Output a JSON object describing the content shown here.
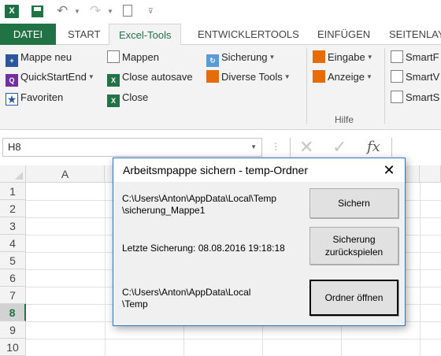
{
  "window": {
    "quick_access": {
      "undo_icon": "undo-icon",
      "redo_icon": "redo-icon",
      "new_document_icon": "new-document-icon"
    },
    "app_icon": "X"
  },
  "ribbon": {
    "tabs": [
      {
        "label": "DATEI"
      },
      {
        "label": "START"
      },
      {
        "label": "Excel-Tools"
      },
      {
        "label": "ENTWICKLERTOOLS"
      },
      {
        "label": "EINFÜGEN"
      },
      {
        "label": "SEITENLAY"
      }
    ],
    "active_tab": "Excel-Tools",
    "buttons": {
      "mappe_neu": "Mappe neu",
      "quickstartend": "QuickStartEnd",
      "favoriten": "Favoriten",
      "mappen": "Mappen",
      "close_autosave": "Close autosave",
      "close": "Close",
      "sicherung": "Sicherung",
      "diverse_tools": "Diverse Tools",
      "eingabe": "Eingabe",
      "anzeige": "Anzeige",
      "smartf": "SmartF",
      "smartv": "SmartV",
      "smarts": "SmartS"
    },
    "group_label_hilfe": "Hilfe"
  },
  "formula_bar": {
    "name_box": "H8",
    "fx_label": "fx"
  },
  "grid": {
    "column_a": "A",
    "rows": [
      "1",
      "2",
      "3",
      "4",
      "5",
      "6",
      "7",
      "8",
      "9",
      "10"
    ],
    "selected_row": "8"
  },
  "dialog": {
    "title": "Arbeitsmpappe sichern - temp-Ordner",
    "path_line1": "C:\\Users\\Anton\\AppData\\Local\\Temp",
    "path_line2": "\\sicherung_Mappe1",
    "last_backup": "Letzte Sicherung: 08.08.2016 19:18:18",
    "folder_line1": "C:\\Users\\Anton\\AppData\\Local",
    "folder_line2": "\\Temp",
    "btn_sichern": "Sichern",
    "btn_restore_line1": "Sicherung",
    "btn_restore_line2": "zurückspielen",
    "btn_open_folder": "Ordner öffnen"
  },
  "colors": {
    "excel_green": "#217346",
    "dialog_border": "#2b78c5",
    "ribbon_bg": "#f3f3f3"
  }
}
